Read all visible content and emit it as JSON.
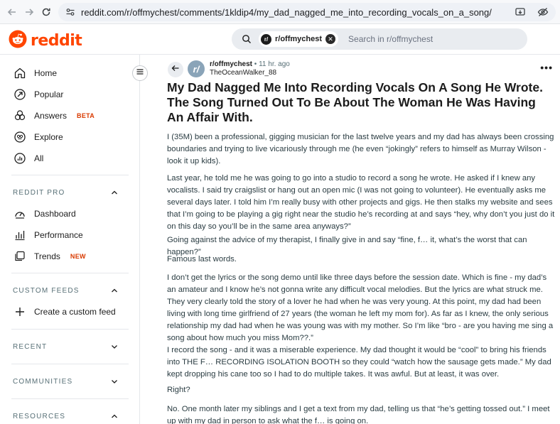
{
  "browser": {
    "url": "reddit.com/r/offmychest/comments/1kldip4/my_dad_nagged_me_into_recording_vocals_on_a_song/"
  },
  "header": {
    "logo_text": "reddit",
    "search_chip": "r/offmychest",
    "search_placeholder": "Search in r/offmychest",
    "brand_color": "#ff4500"
  },
  "sidebar": {
    "nav": [
      {
        "label": "Home",
        "icon": "home-icon"
      },
      {
        "label": "Popular",
        "icon": "popular-icon"
      },
      {
        "label": "Answers",
        "badge": "BETA",
        "icon": "answers-icon"
      },
      {
        "label": "Explore",
        "icon": "explore-icon"
      },
      {
        "label": "All",
        "icon": "all-icon"
      }
    ],
    "reddit_pro": {
      "title": "REDDIT PRO",
      "items": [
        {
          "label": "Dashboard",
          "icon": "dashboard-icon"
        },
        {
          "label": "Performance",
          "icon": "performance-icon"
        },
        {
          "label": "Trends",
          "badge": "NEW",
          "icon": "trends-icon"
        }
      ]
    },
    "custom_feeds": {
      "title": "CUSTOM FEEDS",
      "create_label": "Create a custom feed"
    },
    "recent": {
      "title": "RECENT"
    },
    "communities": {
      "title": "COMMUNITIES"
    },
    "resources": {
      "title": "RESOURCES"
    }
  },
  "post": {
    "subreddit": "r/offmychest",
    "separator": "•",
    "time": "11 hr. ago",
    "author": "TheOceanWalker_88",
    "title": "My Dad Nagged Me Into Recording Vocals On A Song He Wrote. The Song Turned Out To Be About The Woman He Was Having An Affair With.",
    "paragraphs": [
      "I (35M) been a professional, gigging musician for the last twelve years and my dad has always been crossing boundaries and trying to live vicariously through me (he even “jokingly” refers to himself as Murray Wilson - look it up kids).",
      "Last year, he told me he was going to go into a studio to record a song he wrote. He asked if I knew any vocalists. I said try craigslist or hang out an open mic (I was not going to volunteer). He eventually asks me several days later. I told him I’m really busy with other projects and gigs. He then stalks my website and sees that I’m going to be playing a gig right near the studio he’s recording at and says “hey, why don’t you just do it on this day so you’ll be in the same area anyways?”",
      "Going against the advice of my therapist, I finally give in and say “fine, f… it, what’s the worst that can happen?”",
      "Famous last words.",
      "I don’t get the lyrics or the song demo until like three days before the session date. Which is fine - my dad’s an amateur and I know he’s not gonna write any difficult vocal melodies. But the lyrics are what struck me. They very clearly told the story of a lover he had when he was very young. At this point, my dad had been living with long time girlfriend of 27 years (the woman he left my mom for). As far as I knew, the only serious relationship my dad had when he was young was with my mother. So I’m like “bro - are you having me sing a song about how much you miss Mom??.”",
      "I record the song - and it was a miserable experience. My dad thought it would be “cool” to bring his friends into THE F… RECORDING ISOLATION BOOTH so they could “watch how the sausage gets made.” My dad kept dropping his cane too so I had to do multiple takes. It was awful. But at least, it was over.",
      "Right?",
      "No. One month later my siblings and I get a text from my dad, telling us that “he’s getting tossed out.” I meet up with my dad in person to ask what the f… is going on."
    ]
  }
}
